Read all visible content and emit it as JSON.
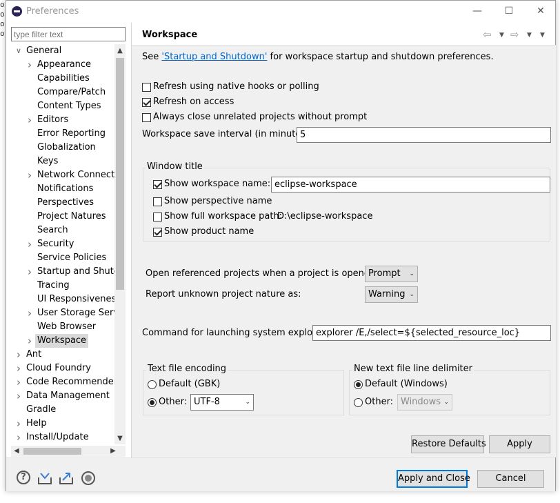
{
  "window": {
    "title": "Preferences"
  },
  "filter": {
    "placeholder": "type filter text"
  },
  "tree": [
    {
      "label": "General",
      "level": 0,
      "expanded": true
    },
    {
      "label": "Appearance",
      "level": 1,
      "expandable": true
    },
    {
      "label": "Capabilities",
      "level": 1
    },
    {
      "label": "Compare/Patch",
      "level": 1
    },
    {
      "label": "Content Types",
      "level": 1
    },
    {
      "label": "Editors",
      "level": 1,
      "expandable": true
    },
    {
      "label": "Error Reporting",
      "level": 1
    },
    {
      "label": "Globalization",
      "level": 1
    },
    {
      "label": "Keys",
      "level": 1
    },
    {
      "label": "Network Connectio",
      "level": 1,
      "expandable": true
    },
    {
      "label": "Notifications",
      "level": 1
    },
    {
      "label": "Perspectives",
      "level": 1
    },
    {
      "label": "Project Natures",
      "level": 1
    },
    {
      "label": "Search",
      "level": 1
    },
    {
      "label": "Security",
      "level": 1,
      "expandable": true
    },
    {
      "label": "Service Policies",
      "level": 1
    },
    {
      "label": "Startup and Shutdo",
      "level": 1,
      "expandable": true
    },
    {
      "label": "Tracing",
      "level": 1
    },
    {
      "label": "UI Responsiveness",
      "level": 1
    },
    {
      "label": "User Storage Servic",
      "level": 1,
      "expandable": true
    },
    {
      "label": "Web Browser",
      "level": 1
    },
    {
      "label": "Workspace",
      "level": 1,
      "expandable": true,
      "selected": true
    },
    {
      "label": "Ant",
      "level": 0,
      "expandable": true
    },
    {
      "label": "Cloud Foundry",
      "level": 0,
      "expandable": true
    },
    {
      "label": "Code Recommenders",
      "level": 0,
      "expandable": true
    },
    {
      "label": "Data Management",
      "level": 0,
      "expandable": true
    },
    {
      "label": "Gradle",
      "level": 0
    },
    {
      "label": "Help",
      "level": 0,
      "expandable": true
    },
    {
      "label": "Install/Update",
      "level": 0,
      "expandable": true
    }
  ],
  "page": {
    "title": "Workspace",
    "see_prefix": "See ",
    "see_link": "'Startup and Shutdown'",
    "see_suffix": " for workspace startup and shutdown preferences.",
    "refresh_native": {
      "label": "Refresh using native hooks or polling",
      "checked": false
    },
    "refresh_access": {
      "label": "Refresh on access",
      "checked": true
    },
    "always_close": {
      "label": "Always close unrelated projects without prompt",
      "checked": false
    },
    "save_interval": {
      "label": "Workspace save interval (in minutes):",
      "value": "5"
    },
    "window_title": {
      "group_label": "Window title",
      "show_workspace_name": {
        "label": "Show workspace name:",
        "checked": true,
        "value": "eclipse-workspace"
      },
      "show_perspective_name": {
        "label": "Show perspective name",
        "checked": false
      },
      "show_full_path": {
        "label": "Show full workspace path:",
        "checked": false,
        "value": "D:\\eclipse-workspace"
      },
      "show_product_name": {
        "label": "Show product name",
        "checked": true
      }
    },
    "open_referenced": {
      "label": "Open referenced projects when a project is opened:",
      "value": "Prompt"
    },
    "report_unknown": {
      "label": "Report unknown project nature as:",
      "value": "Warning"
    },
    "command_explorer": {
      "label": "Command for launching system explorer:",
      "value": "explorer /E,/select=${selected_resource_loc}"
    },
    "encoding": {
      "group_label": "Text file encoding",
      "default_label": "Default (GBK)",
      "other_label": "Other:",
      "selected": "other",
      "other_value": "UTF-8"
    },
    "line_delimiter": {
      "group_label": "New text file line delimiter",
      "default_label": "Default (Windows)",
      "other_label": "Other:",
      "selected": "default",
      "other_value": "Windows"
    }
  },
  "buttons": {
    "restore_defaults": "Restore Defaults",
    "apply": "Apply",
    "apply_close": "Apply and Close",
    "cancel": "Cancel"
  },
  "colors": {
    "accent": "#0078d7",
    "link": "#0066cc",
    "selection": "#d9d9d9"
  }
}
